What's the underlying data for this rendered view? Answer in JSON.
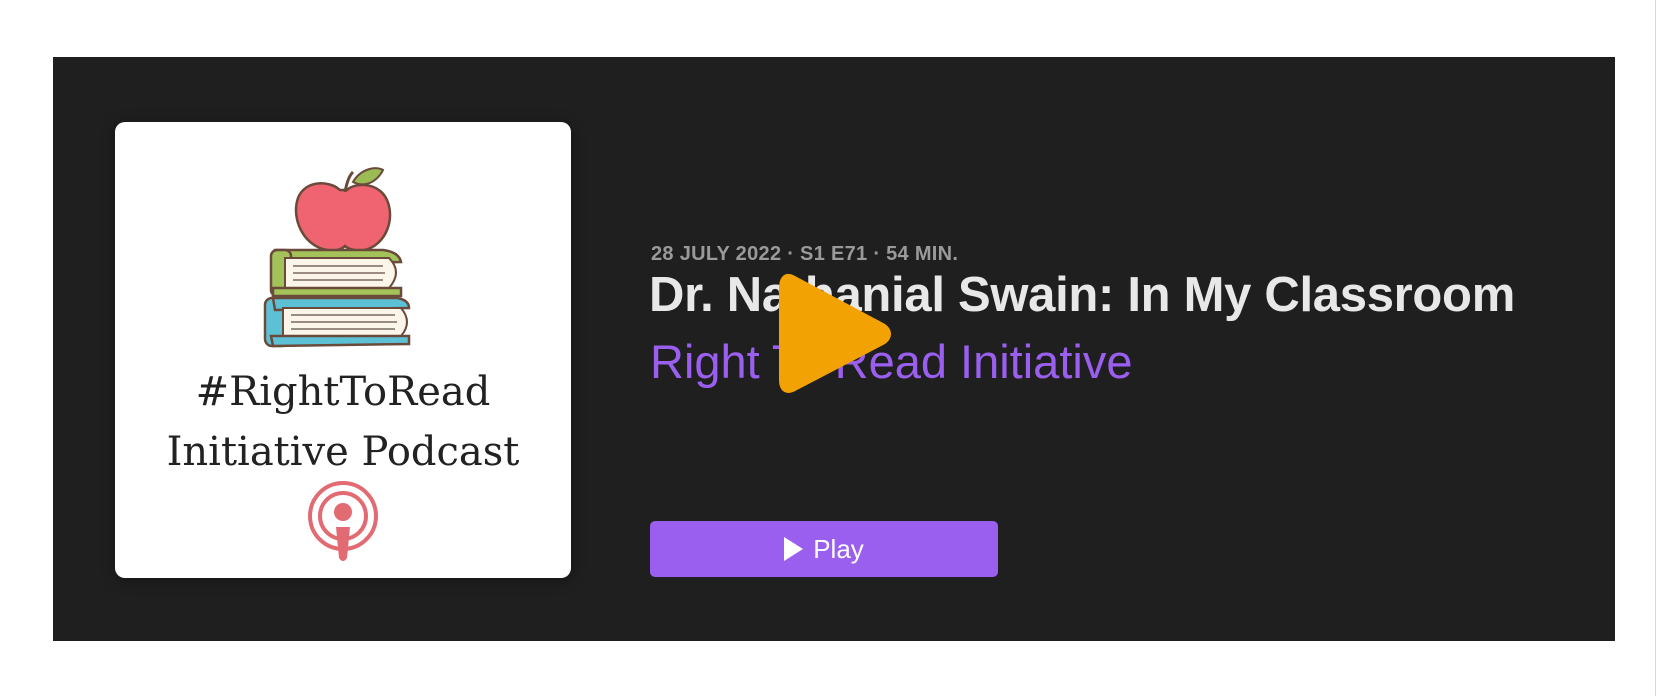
{
  "episode": {
    "meta": "28 JULY 2022 · S1 E71 · 54 MIN.",
    "title": "Dr. Nathanial Swain: In My Classroom",
    "show_name": "Right To Read Initiative",
    "play_label": "Play",
    "artwork": {
      "line1": "#RightToRead",
      "line2": "Initiative Podcast",
      "icons": [
        "apple-icon",
        "books-icon",
        "podcast-icon"
      ]
    }
  },
  "overlay": {
    "icon": "play-icon",
    "color": "#F2A202"
  },
  "colors": {
    "card_background": "#1F1F1F",
    "accent": "#9B5FF0",
    "title": "#E8E8E8",
    "meta": "#9A9A9A"
  }
}
